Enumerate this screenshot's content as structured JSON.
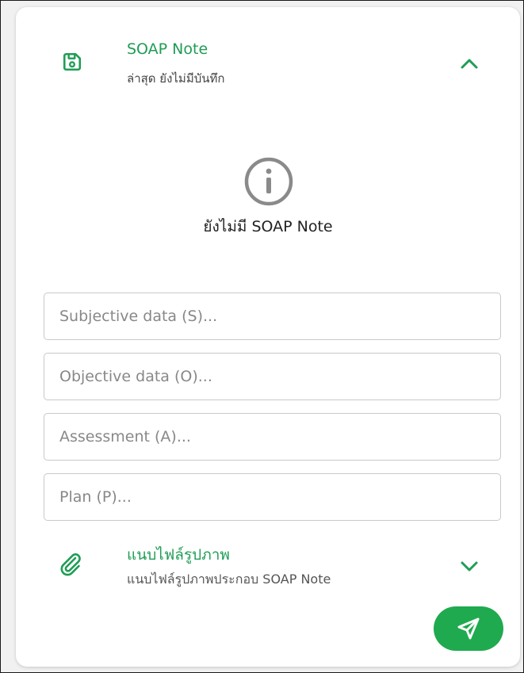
{
  "soap_section": {
    "title": "SOAP Note",
    "subtitle": "ล่าสุด ยังไม่มีบันทึก",
    "collapse_icon": "chevron-up-icon",
    "save_icon": "floppy-disk-icon"
  },
  "empty_state": {
    "icon": "info-circle-icon",
    "message": "ยังไม่มี SOAP Note"
  },
  "fields": {
    "subjective": {
      "placeholder": "Subjective data (S)...",
      "value": ""
    },
    "objective": {
      "placeholder": "Objective data (O)...",
      "value": ""
    },
    "assessment": {
      "placeholder": "Assessment (A)...",
      "value": ""
    },
    "plan": {
      "placeholder": "Plan (P)...",
      "value": ""
    }
  },
  "attachment_section": {
    "title": "แนบไฟล์รูปภาพ",
    "subtitle": "แนบไฟล์รูปภาพประกอบ SOAP Note",
    "icon": "paperclip-icon",
    "expand_icon": "chevron-down-icon"
  },
  "send_button": {
    "icon": "send-icon"
  },
  "colors": {
    "accent": "#1f9d55",
    "button": "#1faa4f",
    "info_icon": "#8a8a8a"
  }
}
